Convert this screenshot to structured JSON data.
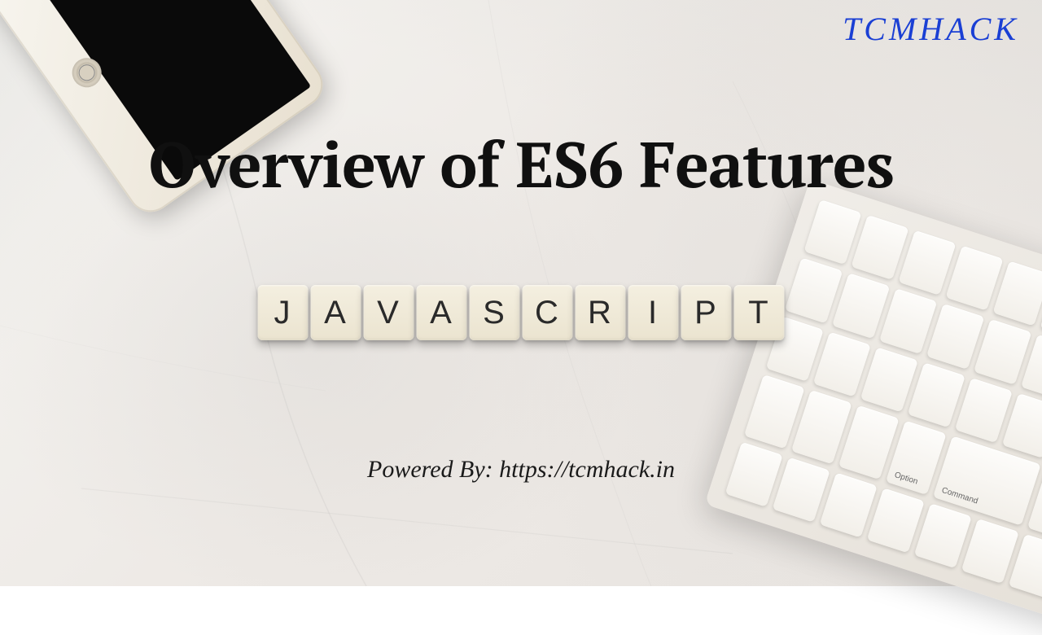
{
  "branding": {
    "logo_text": "TCMHACK"
  },
  "content": {
    "title": "Overview of ES6 Features",
    "tile_letters": [
      "J",
      "A",
      "V",
      "A",
      "S",
      "C",
      "R",
      "I",
      "P",
      "T"
    ],
    "footer": "Powered By: https://tcmhack.in"
  },
  "keyboard": {
    "sample_keys": [
      "",
      "",
      "",
      "",
      "",
      "",
      "",
      "",
      "",
      "",
      "",
      "",
      "",
      "",
      "",
      "",
      "",
      "",
      "",
      "",
      "",
      "",
      "",
      "",
      "",
      "",
      "",
      "Option",
      "Command",
      "",
      "",
      ""
    ]
  },
  "colors": {
    "brand": "#1a3fd4",
    "text": "#101010",
    "tile_bg": "#f4efe0",
    "marble": "#ede9e5"
  }
}
